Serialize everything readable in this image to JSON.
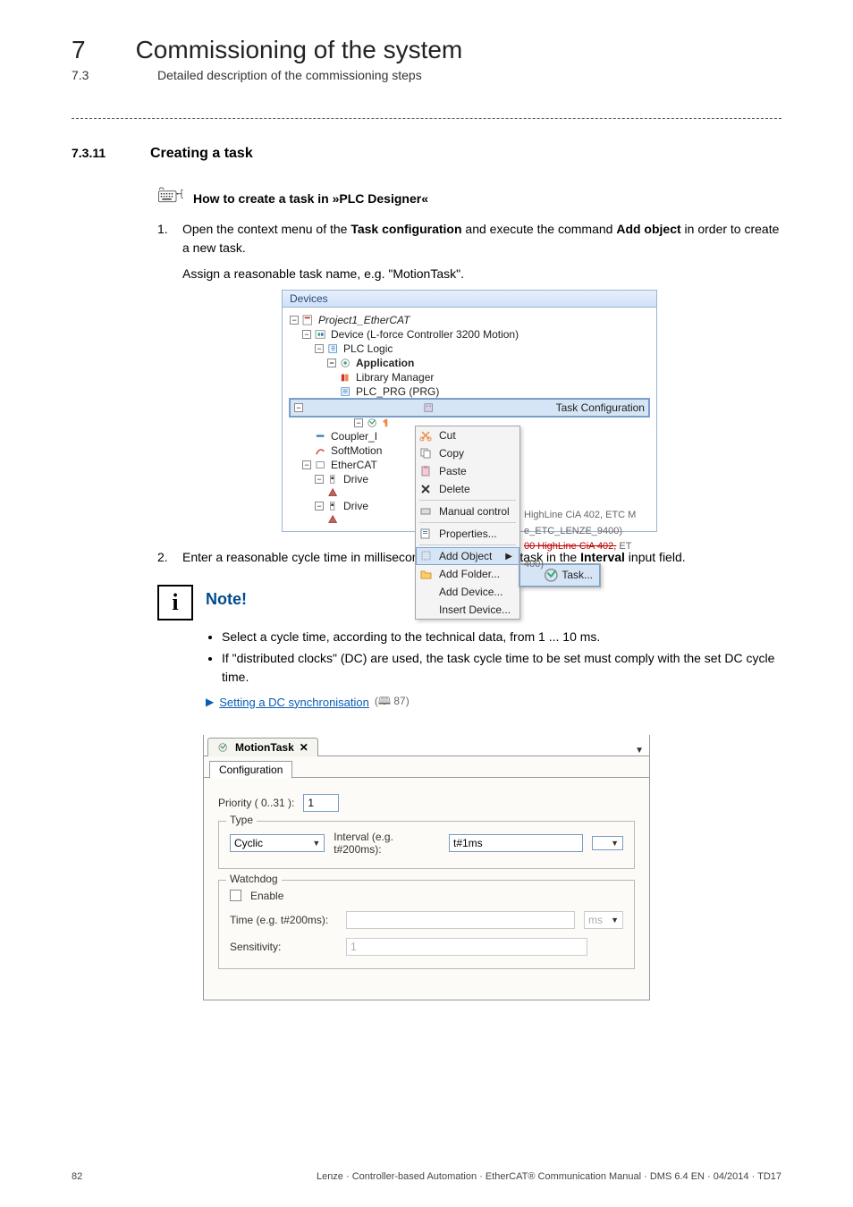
{
  "header": {
    "chapter_num": "7",
    "chapter_title": "Commissioning of the system",
    "sub_num": "7.3",
    "sub_title": "Detailed description of the commissioning steps"
  },
  "section": {
    "num": "7.3.11",
    "title": "Creating a task"
  },
  "procedure": {
    "title": "How to create a task in »PLC Designer«",
    "steps": {
      "s1": {
        "num": "1.",
        "pre": "Open the context menu of the ",
        "bold1": "Task configuration",
        "mid": " and execute the command ",
        "bold2": "Add object",
        "post": " in order to create a new task."
      },
      "s1_extra": "Assign a reasonable task name, e.g. \"MotionTask\".",
      "s2": {
        "num": "2.",
        "pre": "Enter a reasonable cycle time in milliseconds for the created task in the ",
        "bold1": "Interval",
        "post": " input field."
      }
    }
  },
  "devices_panel": {
    "title": "Devices",
    "items": {
      "root": "Project1_EtherCAT",
      "device": "Device (L-force Controller 3200 Motion)",
      "plc": "PLC Logic",
      "app": "Application",
      "lib": "Library Manager",
      "prg": "PLC_PRG (PRG)",
      "taskconf": "Task Configuration",
      "coupler": "Coupler_I",
      "softmotion": "SoftMotion",
      "ethercat": "EtherCAT",
      "drive1": "Drive",
      "drive2": "Drive"
    },
    "rlabels": {
      "r1": "HighLine CiA 402, ETC M",
      "r2": "e_ETC_LENZE_9400)",
      "r3": "00 HighLine CiA 402,",
      "r3b": "ET",
      "r4": "400)"
    }
  },
  "context_menu": {
    "cut": "Cut",
    "copy": "Copy",
    "paste": "Paste",
    "delete": "Delete",
    "manual": "Manual control",
    "props": "Properties...",
    "addobj": "Add Object",
    "addfolder": "Add Folder...",
    "adddev": "Add Device...",
    "insdev": "Insert Device..."
  },
  "submenu": {
    "task": "Task..."
  },
  "note": {
    "title": "Note!",
    "b1": "Select a cycle time, according to the technical data, from 1 ... 10 ms.",
    "b2": "If \"distributed clocks\" (DC) are used, the task cycle time to be set must comply with the set DC cycle time.",
    "link_text": "Setting a DC synchronisation",
    "link_page": "87"
  },
  "task_form": {
    "tab_name": "MotionTask",
    "subtab": "Configuration",
    "priority_label": "Priority ( 0..31 ):",
    "priority_value": "1",
    "type_legend": "Type",
    "type_value": "Cyclic",
    "interval_label": "Interval (e.g. t#200ms):",
    "interval_value": "t#1ms",
    "watchdog_legend": "Watchdog",
    "enable_label": "Enable",
    "time_label": "Time (e.g. t#200ms):",
    "time_unit": "ms",
    "sens_label": "Sensitivity:",
    "sens_value": "1"
  },
  "footer": {
    "page": "82",
    "text": "Lenze · Controller-based Automation · EtherCAT® Communication Manual · DMS 6.4 EN · 04/2014 · TD17"
  }
}
